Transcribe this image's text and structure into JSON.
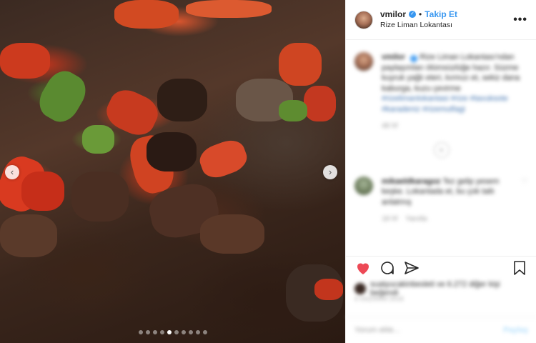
{
  "post": {
    "username": "vmilor",
    "follow_label": "Takip Et",
    "separator": "•",
    "location": "Rize Liman Lokantası",
    "more_label": "•••"
  },
  "photo": {
    "prev_arrow": "‹",
    "next_arrow": "›",
    "slide_count": 10,
    "active_slide": 4
  },
  "caption": {
    "username": "vmilor",
    "text": "Rize Liman Lokantası'ndan paylaşımları ölümsüzlüğe hazır. Süzme kuyruk yağlı eteri, kırmızı et, sekiz dana kaburga, kuzu çevirme",
    "tags": "#rizelimanlokantasi #rize #tavuksote #karadeniz #rizemutfagi",
    "time": "48 hf"
  },
  "comments": [
    {
      "username": "mikaeldkaragoz",
      "text": "Tez gelip yesem keşke. Lokantada et, bu çok tatlı anlatmış",
      "meta_time": "18 hf",
      "meta_reply": "Yanıtla"
    }
  ],
  "likes": {
    "text": "suatyucakinbesleti ve 6.272 diğer kişi beğendi"
  },
  "date": "4 HAZİRAN 2018",
  "comment_box": {
    "placeholder": "Yorum ekle...",
    "post_label": "Paylaş"
  }
}
